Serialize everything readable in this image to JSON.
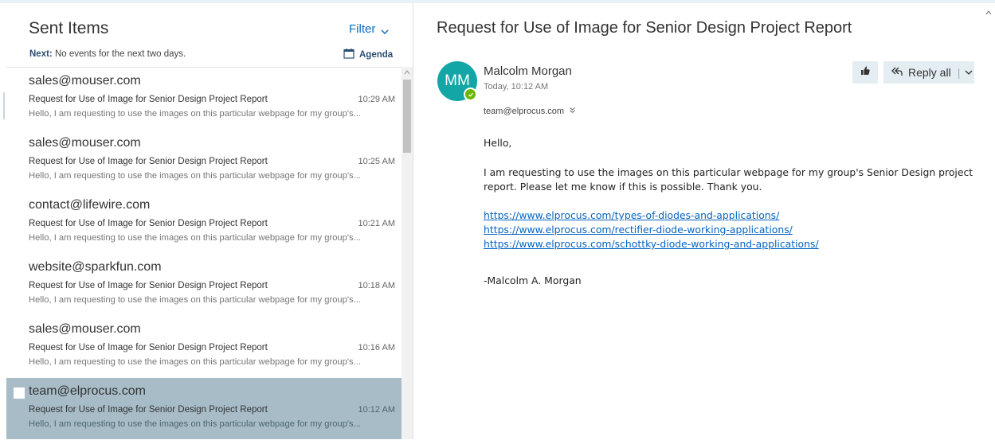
{
  "list": {
    "title": "Sent Items",
    "filter_label": "Filter",
    "next_label": "Next:",
    "next_text": "No events for the next two days.",
    "agenda_label": "Agenda",
    "messages": [
      {
        "sender": "sales@mouser.com",
        "subject": "Request for Use of Image for Senior Design Project Report",
        "time": "10:29 AM",
        "preview": "Hello, I am requesting to use the images on this particular webpage for my group's..."
      },
      {
        "sender": "sales@mouser.com",
        "subject": "Request for Use of Image for Senior Design Project Report",
        "time": "10:25 AM",
        "preview": "Hello, I am requesting to use the images on this particular webpage for my group's..."
      },
      {
        "sender": "contact@lifewire.com",
        "subject": "Request for Use of Image for Senior Design Project Report",
        "time": "10:21 AM",
        "preview": "Hello, I am requesting to use the images on this particular webpage for my group's..."
      },
      {
        "sender": "website@sparkfun.com",
        "subject": "Request for Use of Image for Senior Design Project Report",
        "time": "10:18 AM",
        "preview": "Hello, I am requesting to use the images on this particular webpage for my group's..."
      },
      {
        "sender": "sales@mouser.com",
        "subject": "Request for Use of Image for Senior Design Project Report",
        "time": "10:16 AM",
        "preview": "Hello, I am requesting to use the images on this particular webpage for my group's..."
      },
      {
        "sender": "team@elprocus.com",
        "subject": "Request for Use of Image for Senior Design Project Report",
        "time": "10:12 AM",
        "preview": "Hello, I am requesting to use the images on this particular webpage for my group's...",
        "selected": true
      }
    ]
  },
  "reading": {
    "subject": "Request for Use of Image for Senior Design Project Report",
    "avatar_initials": "MM",
    "sender_name": "Malcolm Morgan",
    "sent_time": "Today, 10:12 AM",
    "recipient": "team@elprocus.com",
    "reply_all_label": "Reply all",
    "greeting": "Hello,",
    "paragraph": "I am requesting to use the images on this particular webpage for my group's Senior Design project report. Please let me know if this is possible. Thank you.",
    "links": [
      "https://www.elprocus.com/types-of-diodes-and-applications/",
      "https://www.elprocus.com/rectifier-diode-working-applications/",
      "https://www.elprocus.com/schottky-diode-working-and-applications/"
    ],
    "signature": "-Malcolm A. Morgan"
  },
  "colors": {
    "accent": "#0b6cc2",
    "selected_row": "#a7bcc7",
    "avatar": "#12a6a6",
    "presence": "#6bb700",
    "link": "#0563c1"
  },
  "icons": [
    "chevron-down-icon",
    "calendar-icon",
    "like-icon",
    "reply-all-icon",
    "scroll-up-icon",
    "expand-recipients-icon",
    "presence-available-icon"
  ]
}
